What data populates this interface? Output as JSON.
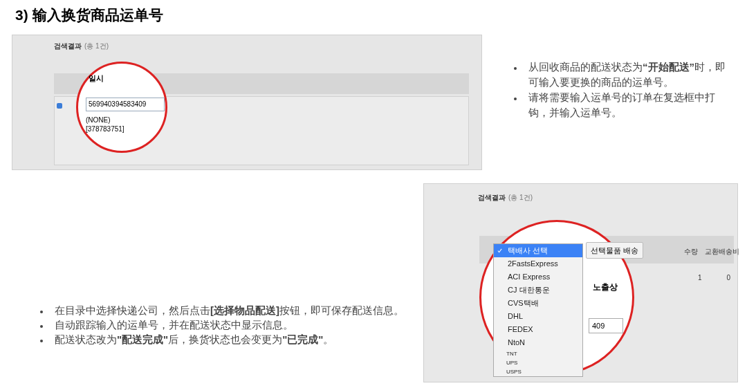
{
  "title": "3) 输入换货商品运单号",
  "top_screenshot": {
    "heading": "검색결과",
    "count": "(총 1건)",
    "row_checked": true,
    "magnifier": {
      "label": "일시",
      "tracking_input": "569940394583409",
      "options": [
        "(NONE)",
        "[378783751]"
      ]
    }
  },
  "top_notes": [
    "从回收商品的配送状态为**“开始配送”**时，即可输入要更换的商品的运单号。",
    "请将需要输入运单号的订单在复选框中打钩，并输入运单号。"
  ],
  "bottom_screenshot": {
    "heading": "검색결과",
    "count": "(총 1건)",
    "ship_button": "선택물품 배송",
    "product_label": "노출상",
    "tracking_input": "409",
    "columns": [
      "수량",
      "교환배송비"
    ],
    "cells": [
      "1",
      "0"
    ],
    "carriers": [
      {
        "label": "택배사 선택",
        "selected": true
      },
      {
        "label": "2FastsExpress",
        "selected": false
      },
      {
        "label": "ACI Express",
        "selected": false
      },
      {
        "label": "CJ 대한통운",
        "selected": false
      },
      {
        "label": "CVS택배",
        "selected": false
      },
      {
        "label": "DHL",
        "selected": false
      },
      {
        "label": "FEDEX",
        "selected": false
      },
      {
        "label": "NtoN",
        "selected": false
      },
      {
        "label": "TNT",
        "selected": false
      },
      {
        "label": "UPS",
        "selected": false
      },
      {
        "label": "USPS",
        "selected": false
      }
    ]
  },
  "bottom_notes": [
    "在目录中选择快递公司，然后点击**[选择物品配送]**按钮，即可保存配送信息。",
    "自动跟踪输入的运单号，并在配送状态中显示信息。",
    "配送状态改为**\"配送完成\"**后，换货状态也会变更为**\"已完成\"**。"
  ]
}
